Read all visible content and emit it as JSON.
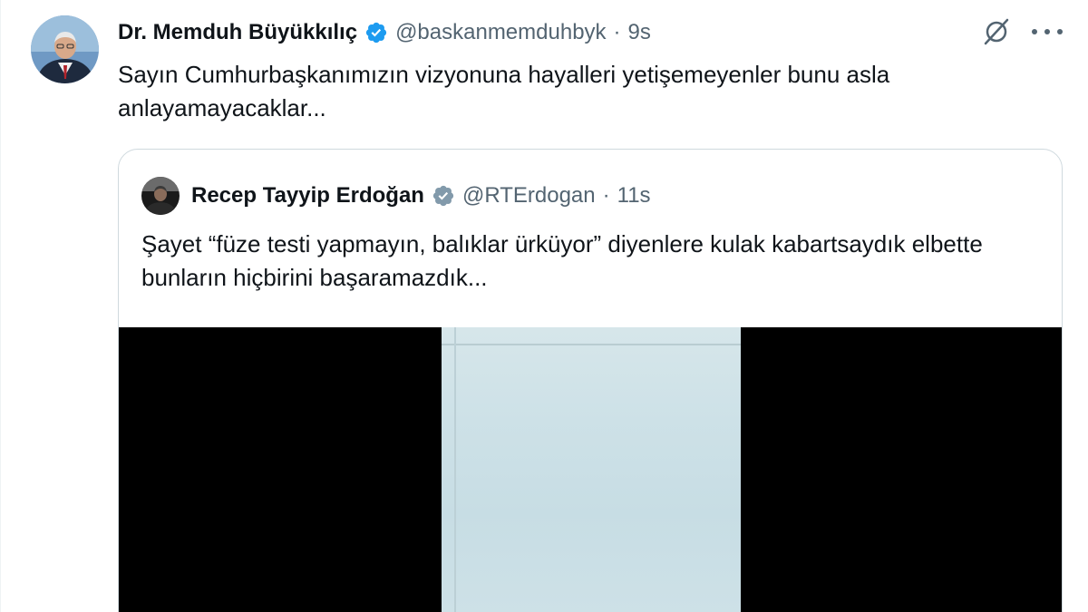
{
  "tweet": {
    "author_name": "Dr. Memduh Büyükkılıç",
    "handle": "@baskanmemduhbyk",
    "separator": "·",
    "time": "9s",
    "text": "Sayın Cumhurbaşkanımızın vizyonuna hayalleri yetişemeyenler bunu asla anlayamayacaklar...",
    "verified_color": "#1d9bf0",
    "avatar_bg": "#4a7ab0"
  },
  "quoted": {
    "author_name": "Recep Tayyip Erdoğan",
    "handle": "@RTErdogan",
    "separator": "·",
    "time": "11s",
    "text": "Şayet “füze testi yapmayın, balıklar ürküyor” diyenlere kulak kabartsaydık elbette bunların hiçbirini başaramazdık...",
    "badge_color": "#829aab"
  },
  "actions": {
    "grok_icon": "grok-icon",
    "more_icon": "more-icon"
  },
  "colors": {
    "text": "#0f1419",
    "secondary": "#536471",
    "border": "#cfd9de",
    "media_bg": "#000000"
  }
}
